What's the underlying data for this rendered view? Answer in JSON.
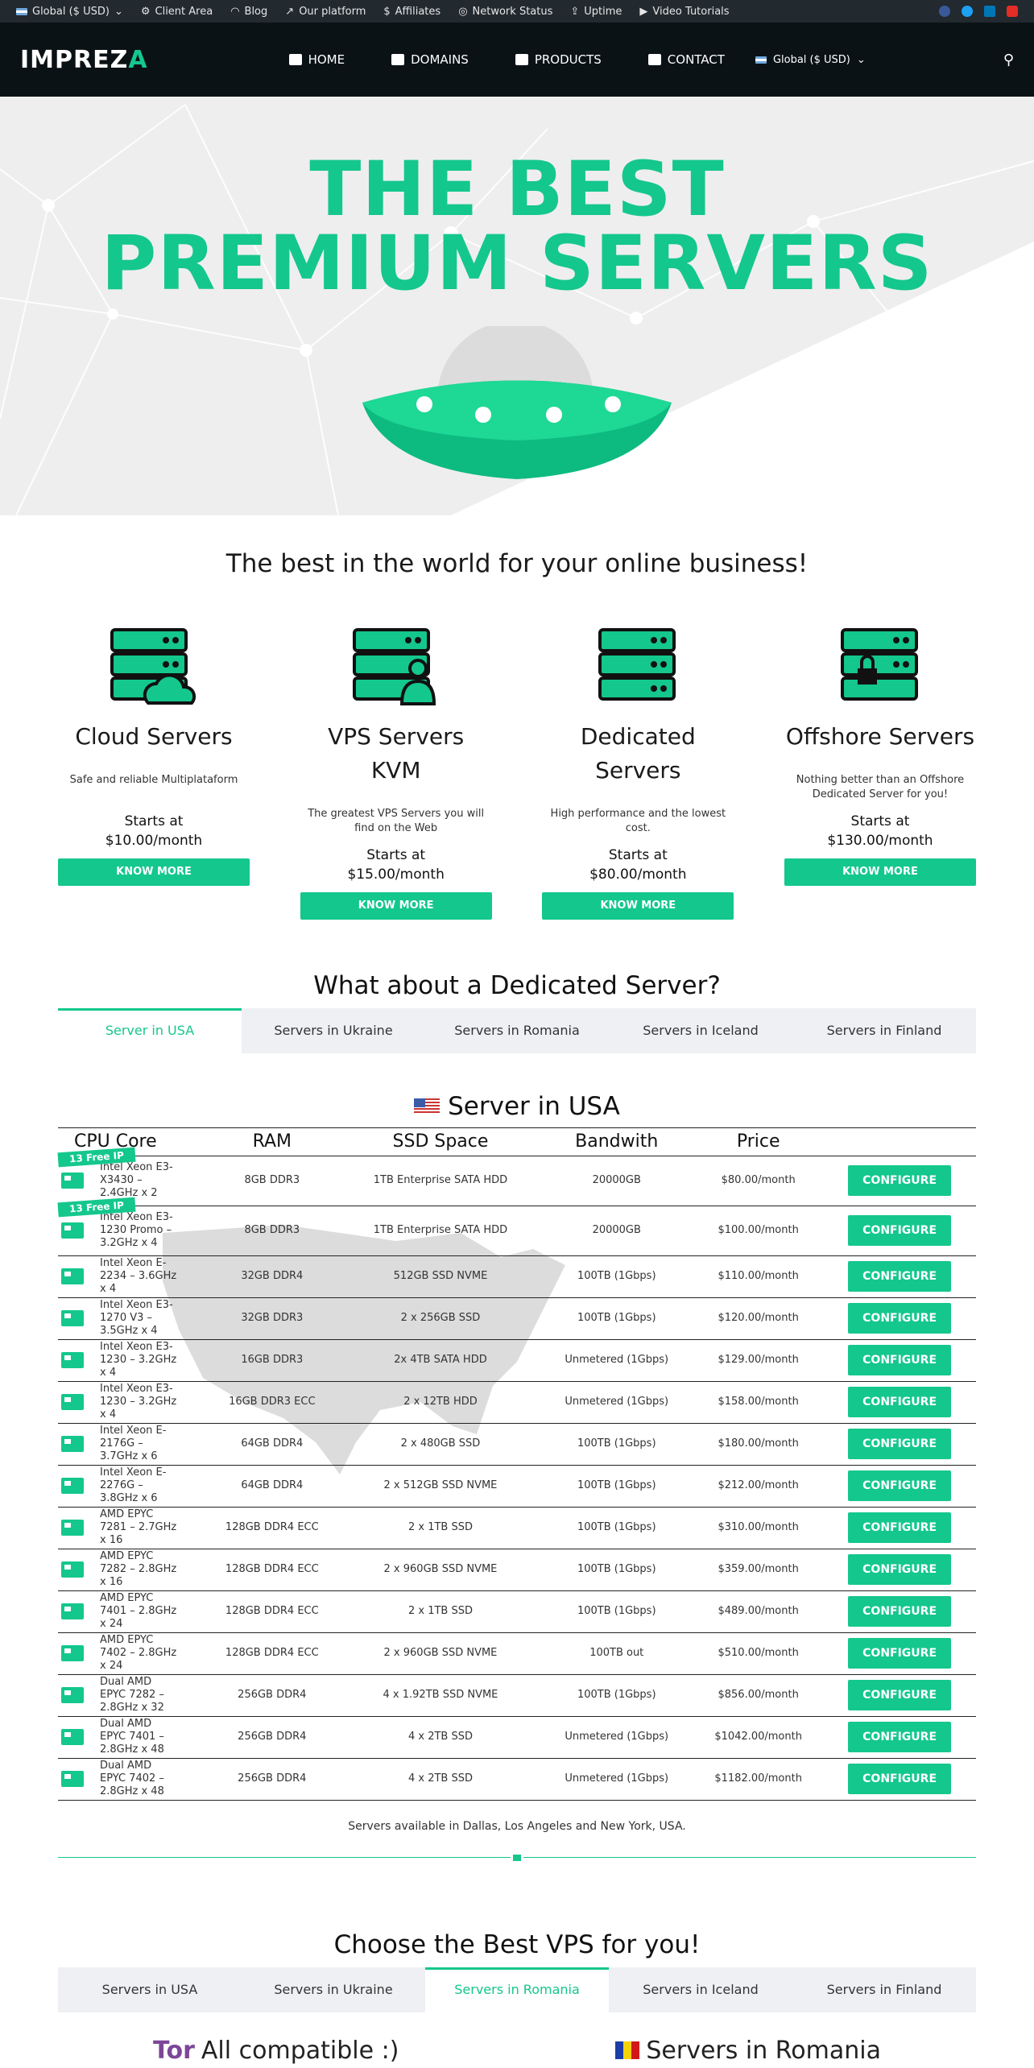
{
  "topbar": {
    "currency": "Global ($ USD)",
    "links": [
      "Client Area",
      "Blog",
      "Our platform",
      "Affiliates",
      "Network Status",
      "Uptime",
      "Video Tutorials"
    ]
  },
  "header": {
    "logo": "IMPREZ",
    "logo_accent": "A",
    "nav": [
      "HOME",
      "DOMAINS",
      "PRODUCTS",
      "CONTACT",
      "Global ($ USD)"
    ]
  },
  "hero": {
    "line1": "THE BEST",
    "line2": "PREMIUM SERVERS"
  },
  "tagline": "The best in the world for your online business!",
  "products": [
    {
      "title": "Cloud Servers",
      "desc": "Safe and reliable Multiplataform",
      "starts": "Starts at",
      "price": "$10.00/month",
      "button": "KNOW MORE"
    },
    {
      "title": "VPS Servers KVM",
      "desc": "The greatest VPS Servers you will find on the Web",
      "starts": "Starts at",
      "price": "$15.00/month",
      "button": "KNOW MORE"
    },
    {
      "title": "Dedicated Servers",
      "desc": "High performance and the lowest cost.",
      "starts": "Starts at",
      "price": "$80.00/month",
      "button": "KNOW MORE"
    },
    {
      "title": "Offshore Servers",
      "desc": "Nothing better than an Offshore Dedicated Server for you!",
      "starts": "Starts at",
      "price": "$130.00/month",
      "button": "KNOW MORE"
    }
  ],
  "dedicated": {
    "title": "What about a Dedicated Server?",
    "tabs": [
      "Server in USA",
      "Servers in Ukraine",
      "Servers in Romania",
      "Servers in Iceland",
      "Servers in Finland"
    ],
    "server_title": "Server in USA",
    "columns": [
      "CPU Core",
      "RAM",
      "SSD Space",
      "Bandwith",
      "Price"
    ],
    "badge": "13 Free IP",
    "configure": "CONFIGURE",
    "rows": [
      {
        "cpu": "Intel Xeon E3-X3430 – 2.4GHz x 2",
        "ram": "8GB DDR3",
        "ssd": "1TB Enterprise SATA HDD",
        "bw": "20000GB",
        "price": "$80.00/month"
      },
      {
        "cpu": "Intel Xeon E3-1230 Promo – 3.2GHz x 4",
        "ram": "8GB DDR3",
        "ssd": "1TB Enterprise SATA HDD",
        "bw": "20000GB",
        "price": "$100.00/month"
      },
      {
        "cpu": "Intel Xeon E-2234 – 3.6GHz x 4",
        "ram": "32GB DDR4",
        "ssd": "512GB SSD NVME",
        "bw": "100TB (1Gbps)",
        "price": "$110.00/month"
      },
      {
        "cpu": "Intel Xeon E3-1270 V3 – 3.5GHz x 4",
        "ram": "32GB DDR3",
        "ssd": "2 x 256GB SSD",
        "bw": "100TB (1Gbps)",
        "price": "$120.00/month"
      },
      {
        "cpu": "Intel Xeon E3-1230 – 3.2GHz x 4",
        "ram": "16GB DDR3",
        "ssd": "2x 4TB SATA HDD",
        "bw": "Unmetered (1Gbps)",
        "price": "$129.00/month"
      },
      {
        "cpu": "Intel Xeon E3-1230 – 3.2GHz x 4",
        "ram": "16GB DDR3 ECC",
        "ssd": "2 x 12TB HDD",
        "bw": "Unmetered (1Gbps)",
        "price": "$158.00/month"
      },
      {
        "cpu": "Intel Xeon E-2176G – 3.7GHz x 6",
        "ram": "64GB DDR4",
        "ssd": "2 x 480GB SSD",
        "bw": "100TB (1Gbps)",
        "price": "$180.00/month"
      },
      {
        "cpu": "Intel Xeon E-2276G – 3.8GHz x 6",
        "ram": "64GB DDR4",
        "ssd": "2 x 512GB SSD NVME",
        "bw": "100TB (1Gbps)",
        "price": "$212.00/month"
      },
      {
        "cpu": "AMD EPYC 7281 – 2.7GHz x 16",
        "ram": "128GB DDR4 ECC",
        "ssd": "2 x 1TB SSD",
        "bw": "100TB (1Gbps)",
        "price": "$310.00/month"
      },
      {
        "cpu": "AMD EPYC 7282 – 2.8GHz x 16",
        "ram": "128GB DDR4 ECC",
        "ssd": "2 x 960GB SSD NVME",
        "bw": "100TB (1Gbps)",
        "price": "$359.00/month"
      },
      {
        "cpu": "AMD EPYC 7401 – 2.8GHz x 24",
        "ram": "128GB DDR4 ECC",
        "ssd": "2 x 1TB SSD",
        "bw": "100TB (1Gbps)",
        "price": "$489.00/month"
      },
      {
        "cpu": "AMD EPYC 7402 – 2.8GHz x 24",
        "ram": "128GB DDR4 ECC",
        "ssd": "2 x 960GB SSD NVME",
        "bw": "100TB out",
        "price": "$510.00/month"
      },
      {
        "cpu": "Dual AMD EPYC 7282 – 2.8GHz x 32",
        "ram": "256GB DDR4",
        "ssd": "4 x 1.92TB SSD NVME",
        "bw": "100TB (1Gbps)",
        "price": "$856.00/month"
      },
      {
        "cpu": "Dual AMD EPYC 7401 – 2.8GHz x 48",
        "ram": "256GB DDR4",
        "ssd": "4 x 2TB SSD",
        "bw": "Unmetered (1Gbps)",
        "price": "$1042.00/month"
      },
      {
        "cpu": "Dual AMD EPYC 7402 – 2.8GHz x 48",
        "ram": "256GB DDR4",
        "ssd": "4 x 2TB SSD",
        "bw": "Unmetered (1Gbps)",
        "price": "$1182.00/month"
      }
    ],
    "availability": "Servers available in Dallas, Los Angeles and New York, USA."
  },
  "vps": {
    "title": "Choose the Best VPS for you!",
    "tabs": [
      "Servers in USA",
      "Servers in Ukraine",
      "Servers in Romania",
      "Servers in Iceland",
      "Servers in Finland"
    ],
    "left_brand": "Tor",
    "left_title": "All compatible :)",
    "right_title": "Servers in Romania"
  },
  "colors": {
    "accent": "#14c78d",
    "topbar": "#22292f",
    "header": "#0b1216"
  }
}
